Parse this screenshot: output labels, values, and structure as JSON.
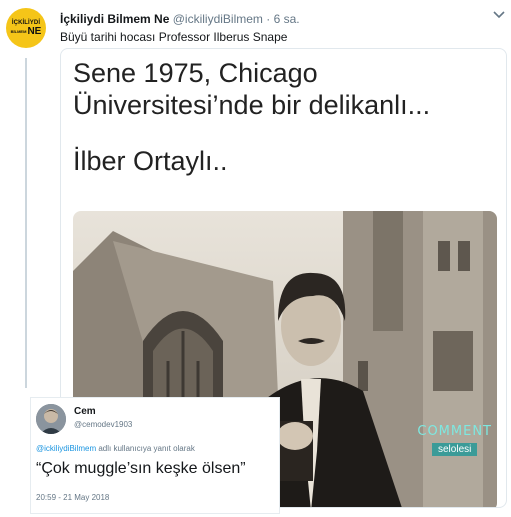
{
  "account": {
    "name": "İçkiliydi Bilmem Ne",
    "handle": "@ickiliydiBilmem",
    "separator": "·",
    "time": "6 sa.",
    "avatar_line1": "İÇKİLİYDİ",
    "avatar_line2_small": "BİLMEM",
    "avatar_line2_big": "NE",
    "avatar_color": "#f5c518"
  },
  "tweet": {
    "text": "Büyü tarihi hocası Professor Ilberus Snape"
  },
  "media": {
    "line1": "Sene 1975, Chicago",
    "line2": "Üniversitesi’nde bir delikanlı...",
    "line3": "İlber Ortaylı..",
    "watermark_top": "COMMENT",
    "watermark_bottom": "selolesi"
  },
  "reply": {
    "name": "Cem",
    "handle": "@cemodev1903",
    "reply_mention": "@ickiliydiBilmem",
    "reply_suffix": "adlı kullanıcıya yanıt olarak",
    "text": "“Çok muggle’sın keşke ölsen”",
    "timestamp": "20:59 - 21 May 2018"
  },
  "icons": {
    "more": "chevron-down-icon"
  },
  "colors": {
    "link": "#1b95e0",
    "muted": "#657786",
    "text": "#14171a"
  }
}
